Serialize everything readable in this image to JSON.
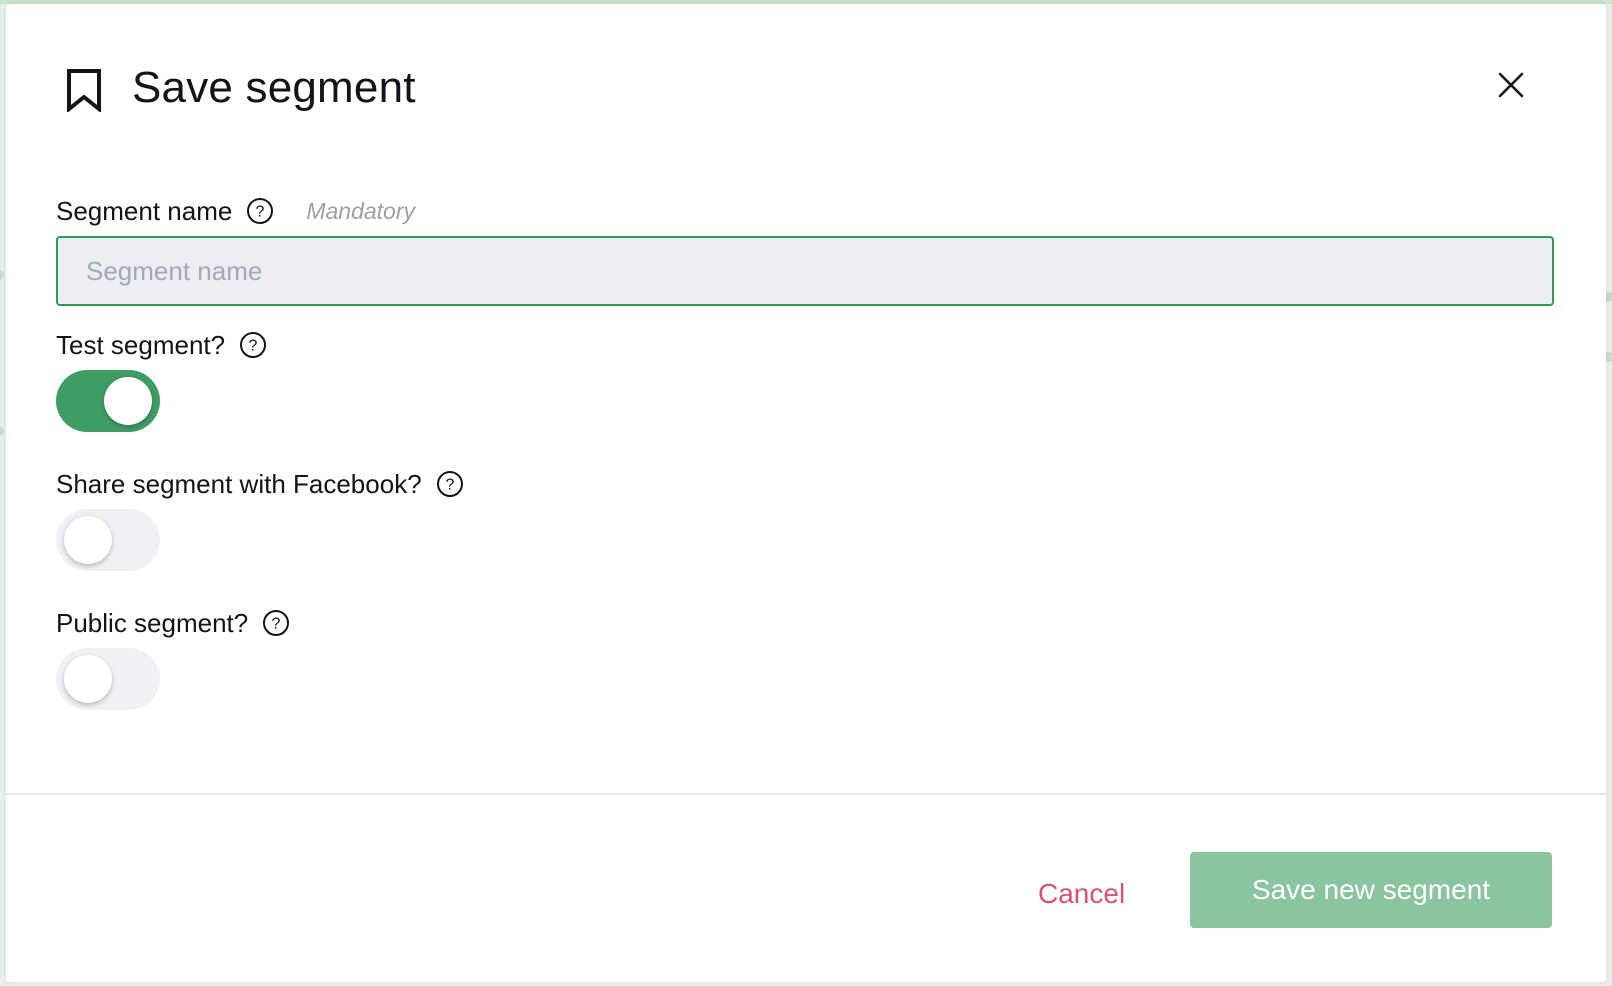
{
  "modal": {
    "title": "Save segment",
    "icons": {
      "title_icon": "bookmark-icon",
      "close": "close-icon",
      "help": "help-icon"
    }
  },
  "segment_name": {
    "label": "Segment name",
    "mandatory_hint": "Mandatory",
    "placeholder": "Segment name",
    "value": ""
  },
  "test_segment": {
    "label": "Test segment?",
    "enabled": true
  },
  "share_facebook": {
    "label": "Share segment with Facebook?",
    "enabled": false
  },
  "public_segment": {
    "label": "Public segment?",
    "enabled": false
  },
  "footer": {
    "cancel_label": "Cancel",
    "save_label": "Save new segment"
  },
  "colors": {
    "accent": "#3f9c64",
    "input_border": "#2f9a55",
    "save_button": "#8ac59f",
    "cancel_text": "#d9546e"
  }
}
